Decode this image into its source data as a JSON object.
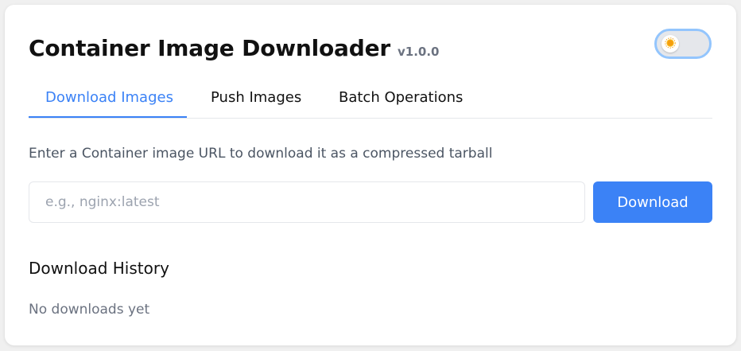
{
  "app": {
    "title": "Container Image Downloader",
    "version": "v1.0.0"
  },
  "theme_toggle": {
    "state": "light",
    "icon": "sun-icon"
  },
  "tabs": [
    {
      "label": "Download Images",
      "active": true
    },
    {
      "label": "Push Images",
      "active": false
    },
    {
      "label": "Batch Operations",
      "active": false
    }
  ],
  "download": {
    "instructions": "Enter a Container image URL to download it as a compressed tarball",
    "url_value": "",
    "url_placeholder": "e.g., nginx:latest",
    "button_label": "Download"
  },
  "history": {
    "title": "Download History",
    "empty_text": "No downloads yet"
  },
  "colors": {
    "accent": "#3b82f6",
    "toggle_border": "#93c5fd",
    "sun": "#f59e0b"
  }
}
